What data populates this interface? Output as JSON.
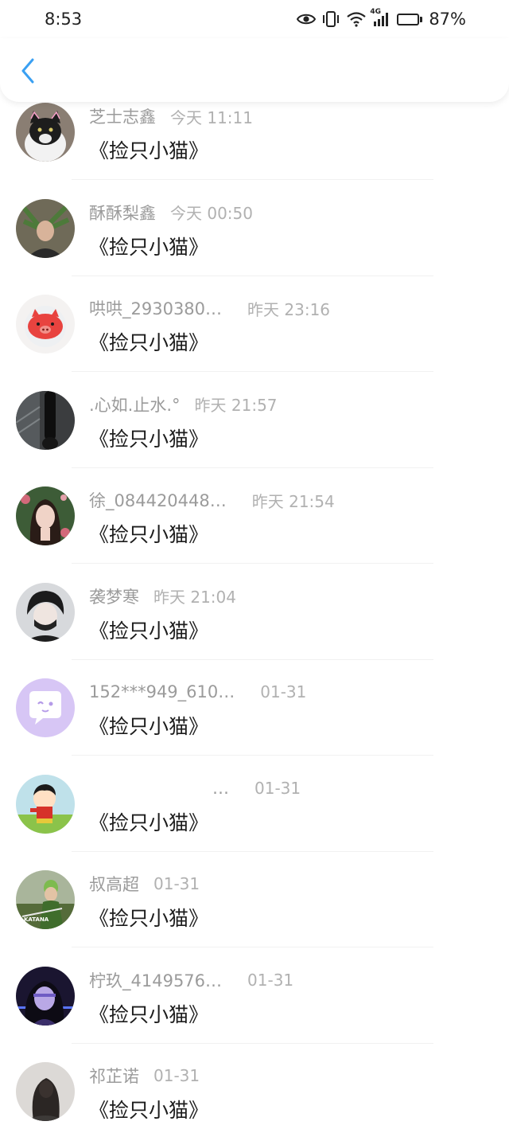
{
  "status_bar": {
    "time": "8:53",
    "network_label": "4G",
    "battery": "87%",
    "battery_level": 0.87,
    "icons": [
      "eye-icon",
      "vibrate-icon",
      "wifi-icon",
      "signal-icon",
      "battery-icon"
    ]
  },
  "header": {
    "back_icon": "chevron-left-icon",
    "accent_color": "#3aa0f2"
  },
  "messages": [
    {
      "name": "芝士志鑫",
      "time": "今天 11:11",
      "text": "《捡只小猫》",
      "avatar": "cat-avatar"
    },
    {
      "name": "酥酥梨鑫",
      "time": "今天 00:50",
      "text": "《捡只小猫》",
      "avatar": "plant-person-avatar"
    },
    {
      "name": "哄哄_2930380…",
      "time": "昨天 23:16",
      "text": "《捡只小猫》",
      "avatar": "pig-avatar"
    },
    {
      "name": ".心如.止水.°",
      "time": "昨天 21:57",
      "text": "《捡只小猫》",
      "avatar": "dark-photo-avatar"
    },
    {
      "name": "徐_084420448…",
      "time": "昨天 21:54",
      "text": "《捡只小猫》",
      "avatar": "girl-avatar"
    },
    {
      "name": "袭梦寒",
      "time": "昨天 21:04",
      "text": "《捡只小猫》",
      "avatar": "masked-boy-avatar"
    },
    {
      "name": "152***949_610…",
      "time": "01-31",
      "text": "《捡只小猫》",
      "avatar": "chat-bubble-avatar"
    },
    {
      "name": "…",
      "time": "01-31",
      "text": "《捡只小猫》",
      "avatar": "cartoon-boy-avatar"
    },
    {
      "name": "叔高超",
      "time": "01-31",
      "text": "《捡只小猫》",
      "avatar": "swordsman-avatar"
    },
    {
      "name": "柠玖_4149576…",
      "time": "01-31",
      "text": "《捡只小猫》",
      "avatar": "neon-girl-avatar"
    },
    {
      "name": "祁芷诺",
      "time": "01-31",
      "text": "《捡只小猫》",
      "avatar": "long-hair-avatar"
    }
  ]
}
